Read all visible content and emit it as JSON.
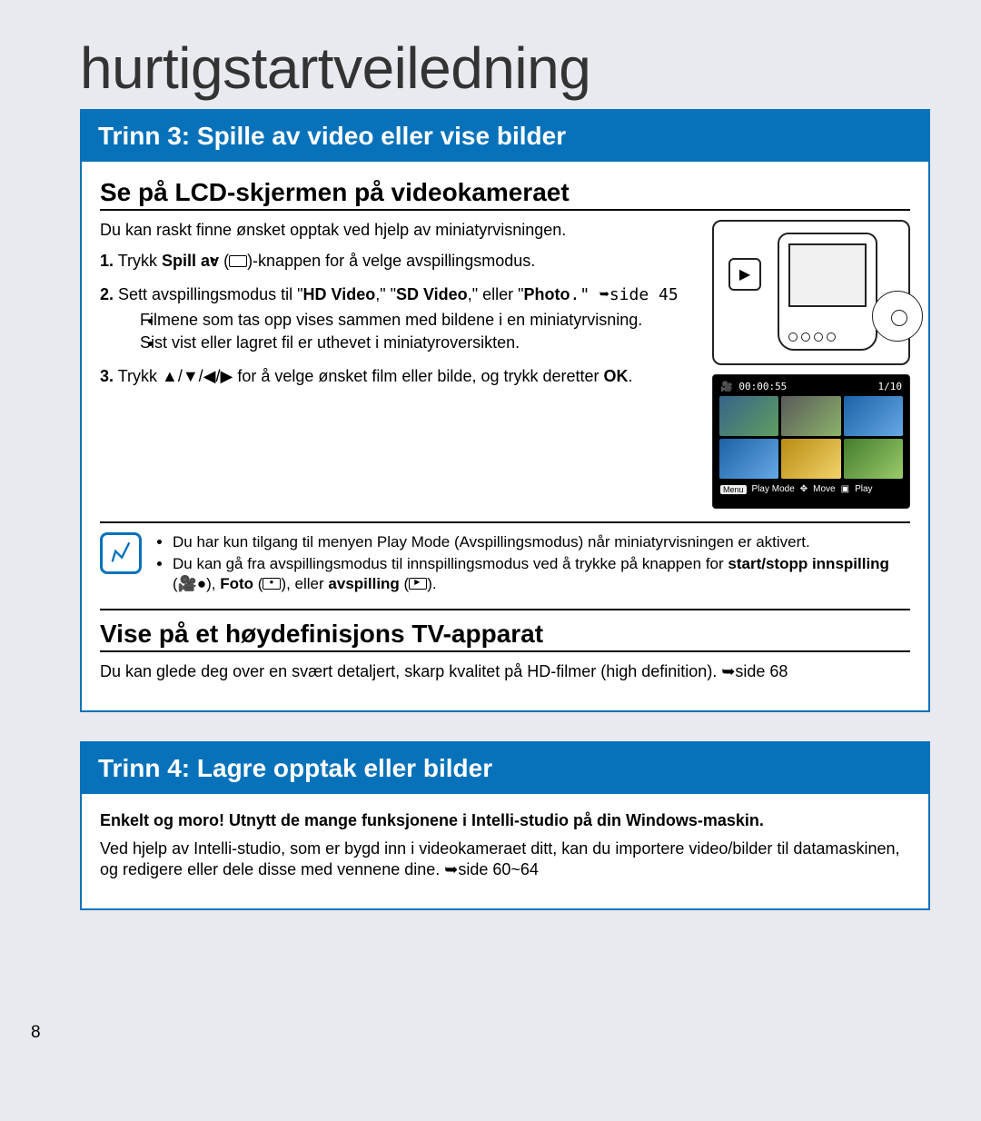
{
  "pageTitle": "hurtigstartveiledning",
  "pageNumber": "8",
  "step3": {
    "header": "Trinn 3: Spille av video eller vise bilder",
    "subA": "Se på LCD-skjermen på videokameraet",
    "intro": "Du kan raskt finne ønsket opptak ved hjelp av miniatyrvisningen.",
    "li1_a": "Trykk ",
    "li1_b": "Spill av",
    "li1_c": " (",
    "li1_d": ")-knappen for å velge avspillingsmodus.",
    "li2_a": "Sett avspillingsmodus til \"",
    "li2_b": "HD Video",
    "li2_c": ",\" \"",
    "li2_d": "SD Video",
    "li2_e": ",\" eller \"",
    "li2_f": "Photo",
    "li2_g": ".\" ➥side 45",
    "li2_bul1": "Filmene som tas opp vises sammen med bildene i en miniatyrvisning.",
    "li2_bul2": "Sist vist eller lagret fil er uthevet i miniatyroversikten.",
    "li3_a": "Trykk ▲/▼/◀/▶ for å velge ønsket film eller bilde, og trykk deretter ",
    "li3_b": "OK",
    "li3_c": ".",
    "thumbTime": "00:00:55",
    "thumbIndex": "1/10",
    "thumbMenuLabel": "Menu",
    "thumbPlayMode": "Play Mode",
    "thumbMove": "Move",
    "thumbPlay": "Play",
    "note1": "Du har kun tilgang til menyen Play Mode (Avspillingsmodus) når miniatyrvisningen er aktivert.",
    "note2_a": "Du kan gå fra avspillingsmodus til innspillingsmodus ved å trykke på knappen for ",
    "note2_b": "start/stopp innspilling",
    "note2_c": " (",
    "note2_d": "), ",
    "note2_e": "Foto",
    "note2_f": " (",
    "note2_g": "), eller ",
    "note2_h": "avspilling",
    "note2_i": " (",
    "note2_j": ").",
    "subB": "Vise på et høydefinisjons TV-apparat",
    "tvText": "Du kan glede deg over en svært detaljert, skarp kvalitet på HD-filmer (high definition). ➥side 68"
  },
  "step4": {
    "header": "Trinn 4: Lagre opptak eller bilder",
    "bold": "Enkelt og moro! Utnytt de mange funksjonene i Intelli-studio på din Windows-maskin.",
    "body": "Ved hjelp av Intelli-studio, som er bygd inn i videokameraet ditt, kan du importere video/bilder til datamaskinen, og redigere eller dele disse med vennene dine. ➥side 60~64"
  }
}
